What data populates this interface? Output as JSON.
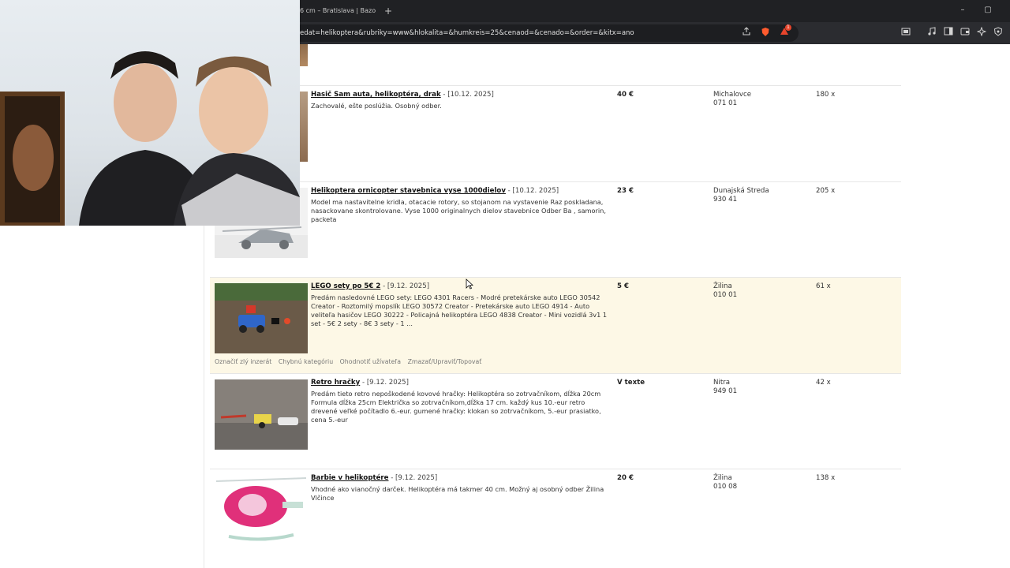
{
  "browser": {
    "tab_title": "6 cm – Bratislava | Bazo",
    "new_tab": "+",
    "url": "edat=helikoptera&rubriky=www&hlokalita=&humkreis=25&cenaod=&cenado=&order=&kitx=ano",
    "rewards_badge": "1",
    "window_controls": [
      "–",
      "▢"
    ]
  },
  "listings": [
    {
      "title": "Hasič Sam auta, helikoptéra, drak",
      "date": "- [10.12. 2025]",
      "description": "Zachovalé, ešte poslúžia. Osobný odber.",
      "price": "40 €",
      "city": "Michalovce",
      "zip": "071 01",
      "views": "180 x",
      "highlighted": false
    },
    {
      "title": "Helikoptera ornicopter stavebnica vyse 1000dielov",
      "date": "- [10.12. 2025]",
      "description": "Model ma nastavitelne kridla, otacacie rotory, so stojanom na vystavenie Raz poskladana, nasackovane skontrolovane. Vyse 1000 originalnych dielov stavebnice Odber Ba , samorin, packeta",
      "price": "23 €",
      "city": "Dunajská Streda",
      "zip": "930 41",
      "views": "205 x",
      "highlighted": false
    },
    {
      "title": "LEGO sety po 5€ 2",
      "date": "- [9.12. 2025]",
      "description": "Predám nasledovné LEGO sety: LEGO 4301 Racers - Modré pretekárske auto LEGO 30542 Creator - Roztomilý mopslík LEGO 30572 Creator - Pretekárske auto LEGO 4914 - Auto veliteľa hasičov LEGO 30222 - Policajná helikoptéra LEGO 4838 Creator - Mini vozidlá 3v1 1 set - 5€ 2 sety - 8€ 3 sety - 1 ...",
      "price": "5 €",
      "city": "Žilina",
      "zip": "010 01",
      "views": "61 x",
      "highlighted": true,
      "actions": [
        "Označiť zlý inzerát",
        "Chybnú kategóriu",
        "Ohodnotiť užívateľa",
        "Zmazať/Upraviť/Topovať"
      ]
    },
    {
      "title": "Retro hračky",
      "date": "- [9.12. 2025]",
      "description": "Predám tieto retro nepoškodené kovové hračky: Helikoptéra so zotrvačníkom, dĺžka 20cm Formula dĺžka 25cm Električka so zotrvačníkom,dĺžka 17 cm. každý kus 10.-eur retro drevené veľké počítadlo 6.-eur. gumené hračky: klokan so zotrvačníkom, 5.-eur prasiatko, cena 5.-eur",
      "price": "V texte",
      "city": "Nitra",
      "zip": "949 01",
      "views": "42 x",
      "highlighted": false
    },
    {
      "title": "Barbie v helikoptére",
      "date": "- [9.12. 2025]",
      "description": "Vhodné ako vianočný darček. Helikoptéra má takmer 40 cm. Možný aj osobný odber Žilina Vlčince",
      "price": "20 €",
      "city": "Žilina",
      "zip": "010 08",
      "views": "138 x",
      "highlighted": false
    }
  ]
}
